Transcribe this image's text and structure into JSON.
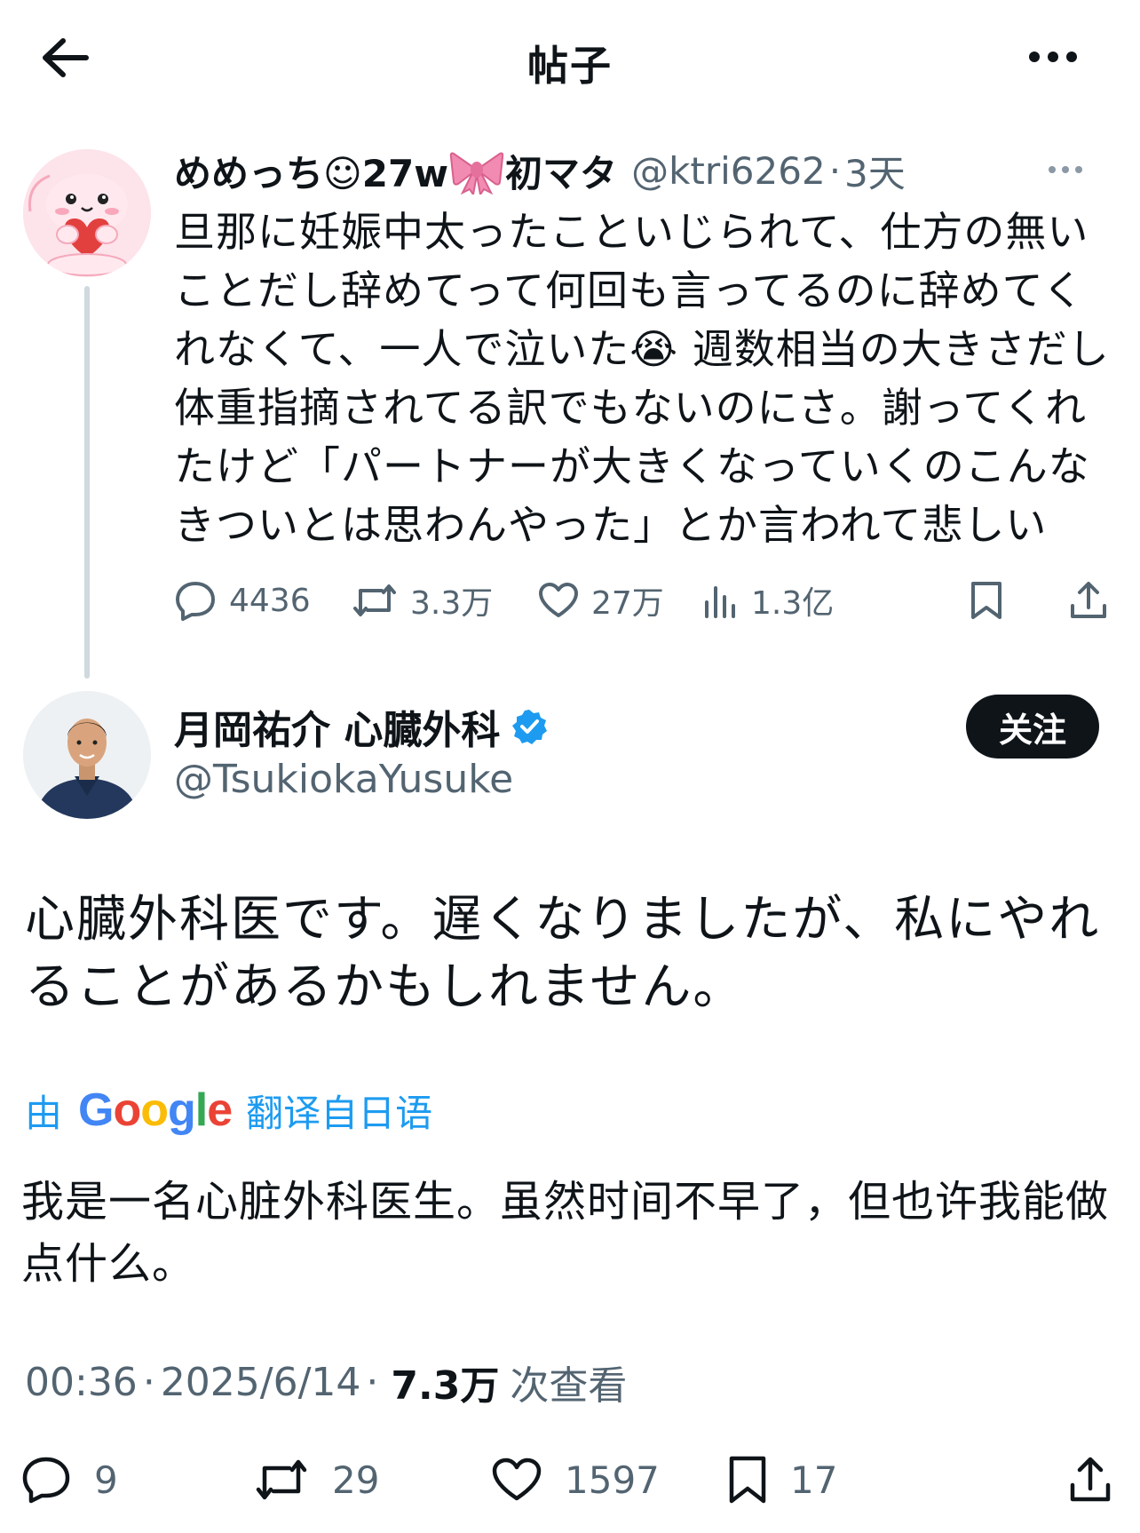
{
  "header": {
    "title": "帖子",
    "back_icon": "arrow-left-icon",
    "more_icon": "more-horizontal-icon"
  },
  "original_post": {
    "display_name": "めめっち☺27w",
    "display_name_suffix": "初マタ",
    "handle": "@ktri6262",
    "separator": "·",
    "time": "3天",
    "text": "旦那に妊娠中太ったこといじられて、仕方の無いことだし辞めてって何回も言ってるのに辞めてくれなくて、一人で泣いた😭 週数相当の大きさだし体重指摘されてる訳でもないのにさ。謝ってくれたけど「パートナーが大きくなっていくのこんなきついとは思わんやった」とか言われて悲しい",
    "actions": {
      "replies": "4436",
      "reposts": "3.3万",
      "likes": "27万",
      "views": "1.3亿"
    }
  },
  "reply_post": {
    "display_name": "月岡祐介 心臓外科",
    "handle": "@TsukiokaYusuke",
    "follow_label": "关注",
    "verified_color": "#1d9bf0",
    "text": "心臓外科医です。遅くなりましたが、私にやれることがあるかもしれません。",
    "translate": {
      "prefix": "由",
      "brand": "Google",
      "suffix": "翻译自日语"
    },
    "translated_text": "我是一名心脏外科医生。虽然时间不早了，但也许我能做点什么。",
    "meta": {
      "time": "00:36",
      "sep1": "·",
      "date": "2025/6/14",
      "sep2": "·",
      "views": "7.3万",
      "views_label": "次查看"
    },
    "actions": {
      "replies": "9",
      "reposts": "29",
      "likes": "1597",
      "bookmarks": "17"
    }
  },
  "colors": {
    "text_primary": "#0f1419",
    "text_secondary": "#536471",
    "link_blue": "#1d9bf0",
    "thread_line": "#cfd9de"
  }
}
